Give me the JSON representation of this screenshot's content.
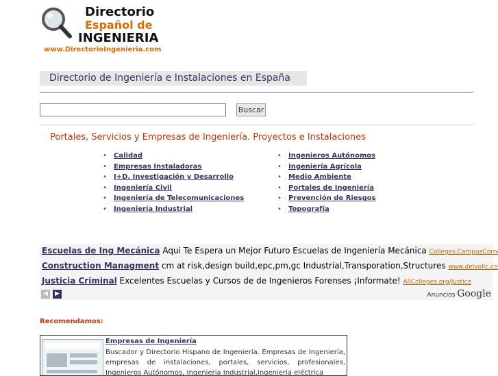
{
  "logo": {
    "line1": "Directorio",
    "line2": "Español de",
    "line3": "INGENIERIA",
    "url": "www.DirectorioIngenieria.com"
  },
  "header": {
    "title": "Directorio de Ingeniería e Instalaciones en España"
  },
  "search": {
    "value": "",
    "button_label": "Buscar"
  },
  "section": {
    "title": "Portales, Servicios y Empresas de Ingeniería. Proyectos e Instalaciones"
  },
  "categories": {
    "left": [
      {
        "label": "Calidad"
      },
      {
        "label": "Empresas Instaladoras"
      },
      {
        "label": "I+D. Investigación y Desarrollo"
      },
      {
        "label": "Ingeniería Civil"
      },
      {
        "label": "Ingeniería de Telecomunicaciones"
      },
      {
        "label": "Ingeniería Industrial"
      }
    ],
    "right": [
      {
        "label": "Ingenieros Autónomos"
      },
      {
        "label": "Ingeniería Agrícola"
      },
      {
        "label": "Medio Ambiente"
      },
      {
        "label": "Portales de Ingeniería"
      },
      {
        "label": "Prevención de Riesgos"
      },
      {
        "label": "Topografía"
      }
    ]
  },
  "ads": {
    "items": [
      {
        "title": "Escuelas de Ing Mecánica",
        "text": "Aqui Te Espera un Mejor Futuro Escuelas de Ingeniería Mecánica",
        "url": "Colleges.CampusCorner.com"
      },
      {
        "title": "Construction Managment",
        "text": "cm at risk,design build,epc,pm,gc Industrial,Transporation,Structures",
        "url": "www.delvollc.com"
      },
      {
        "title": "Justicia Criminal",
        "text": "Excelentes Escuelas y Cursos de de Ingenieros Forenses ¡Informate!",
        "url": "AllColleges.org/Justice"
      }
    ],
    "prev_label": "◀",
    "next_label": "▶",
    "anuncios": "Anuncios",
    "google": "Google"
  },
  "recommend": {
    "heading": "Recomendamos:",
    "title": "Empresas de Ingeniería",
    "description": "Buscador y Directorio Hispano de Ingeniería. Empresas de Ingeniería, empresas de instalaciones, portales, servicios, profesionales, Ingenieros Autónomos, Ingenieria Industrial,Ingenieria eléctrica"
  }
}
